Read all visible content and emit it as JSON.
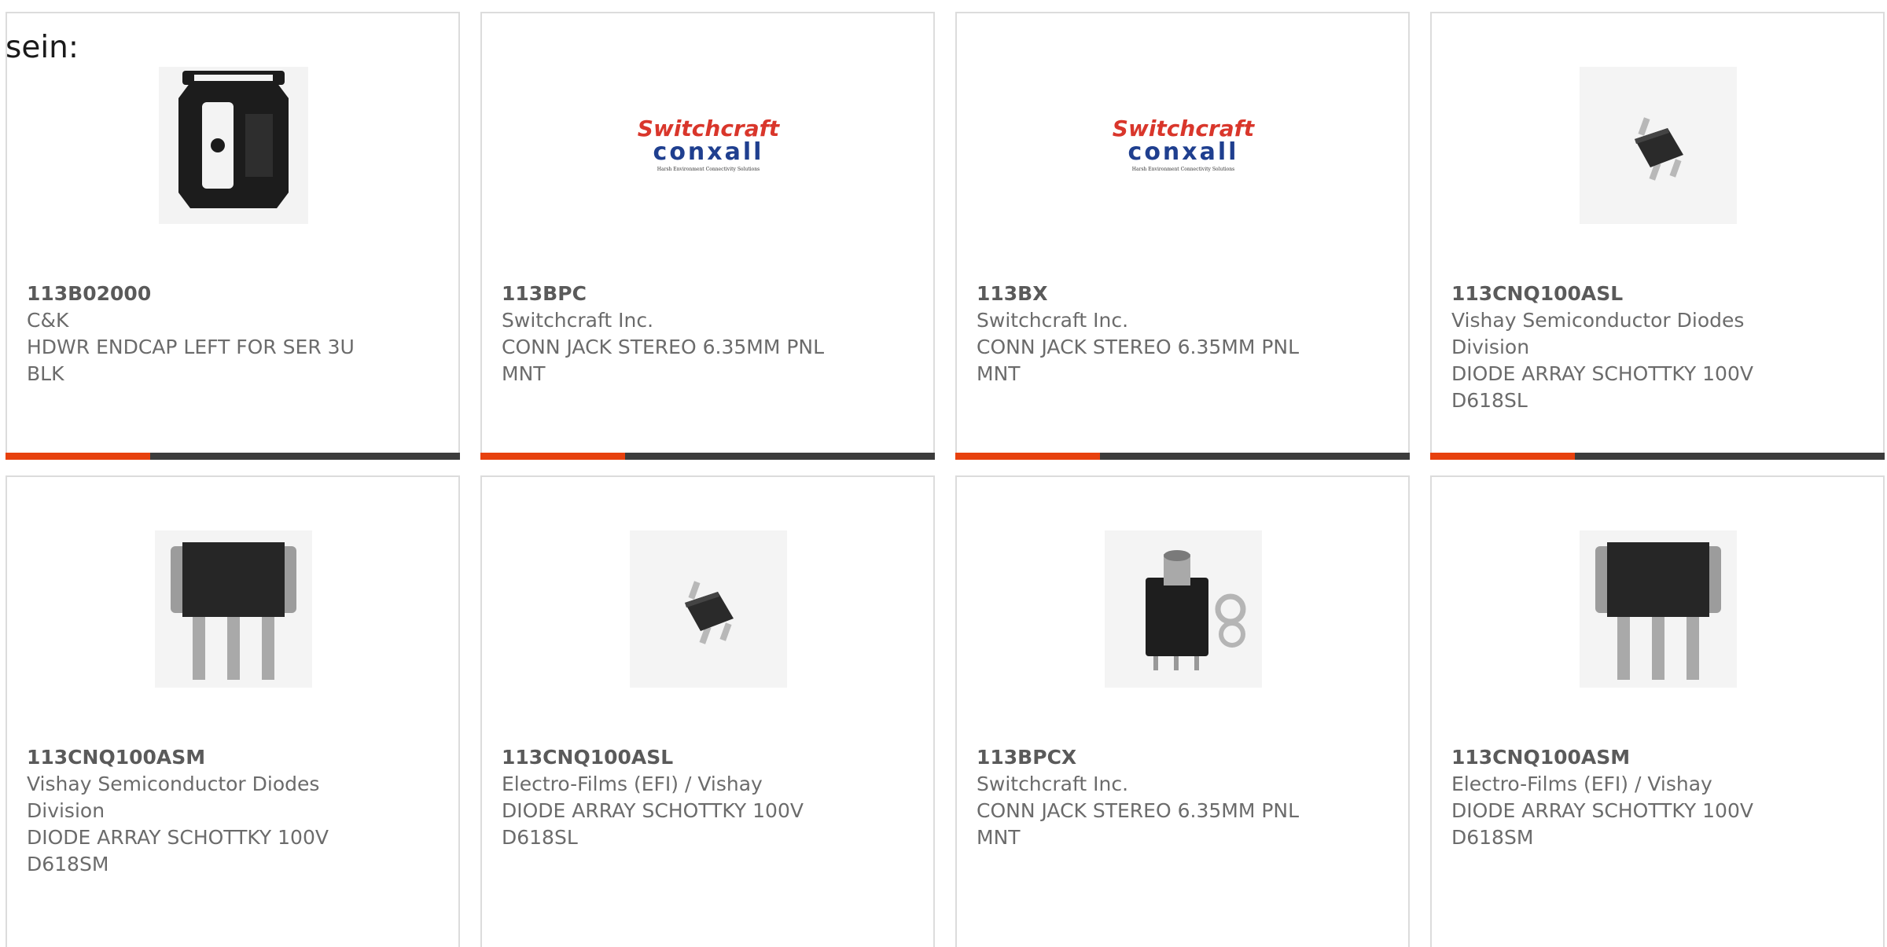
{
  "intro_text": "sein:",
  "products": [
    {
      "part": "113B02000",
      "maker": "C&K",
      "desc1": "HDWR ENDCAP LEFT FOR SER 3U",
      "desc2": "BLK",
      "image": "endcap-bracket-image"
    },
    {
      "part": "113BPC",
      "maker": "Switchcraft Inc.",
      "desc1": "CONN JACK STEREO 6.35MM PNL",
      "desc2": "MNT",
      "image": "switchcraft-conxall-logo"
    },
    {
      "part": "113BX",
      "maker": "Switchcraft Inc.",
      "desc1": "CONN JACK STEREO 6.35MM PNL",
      "desc2": "MNT",
      "image": "switchcraft-conxall-logo"
    },
    {
      "part": "113CNQ100ASL",
      "maker": "Vishay Semiconductor Diodes",
      "maker2": "Division",
      "desc1": "DIODE ARRAY SCHOTTKY 100V",
      "desc2": "D618SL",
      "image": "smd-diode-image"
    },
    {
      "part": "113CNQ100ASM",
      "maker": "Vishay Semiconductor Diodes",
      "maker2": "Division",
      "desc1": "DIODE ARRAY SCHOTTKY 100V",
      "desc2": "D618SM",
      "image": "power-diode-image"
    },
    {
      "part": "113CNQ100ASL",
      "maker": "Electro-Films (EFI) / Vishay",
      "desc1": "DIODE ARRAY SCHOTTKY 100V",
      "desc2": "D618SL",
      "image": "smd-diode-image"
    },
    {
      "part": "113BPCX",
      "maker": "Switchcraft Inc.",
      "desc1": "CONN JACK STEREO 6.35MM PNL",
      "desc2": "MNT",
      "image": "audio-jack-image"
    },
    {
      "part": "113CNQ100ASM",
      "maker": "Electro-Films (EFI) / Vishay",
      "desc1": "DIODE ARRAY SCHOTTKY 100V",
      "desc2": "D618SM",
      "image": "power-diode-image"
    }
  ],
  "logo": {
    "line1": "Switchcraft",
    "line2": "conxall",
    "tagline": "Harsh Environment Connectivity Solutions"
  },
  "colors": {
    "accent_orange": "#e7410e",
    "accent_dark": "#3c3c3c",
    "border": "#dcdcdc",
    "text": "#6b6b6b"
  }
}
